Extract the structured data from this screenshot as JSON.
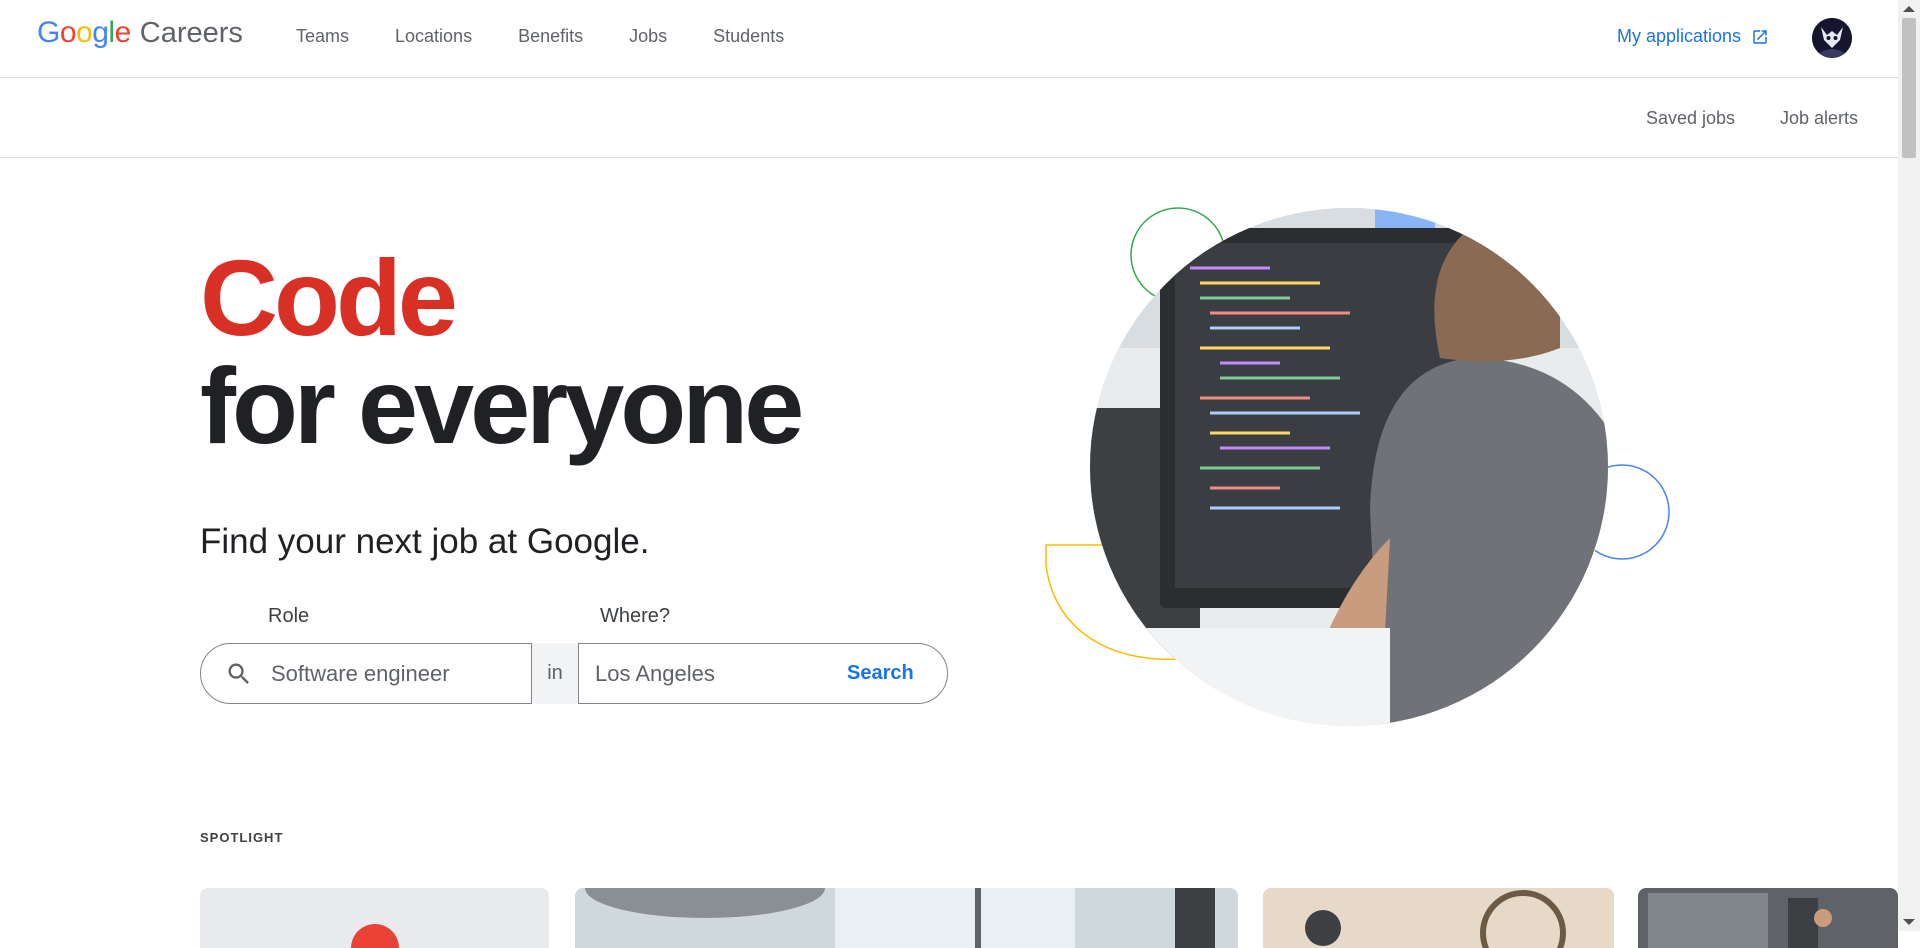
{
  "header": {
    "logo_google": "Google",
    "logo_careers": "Careers",
    "nav": [
      "Teams",
      "Locations",
      "Benefits",
      "Jobs",
      "Students"
    ],
    "my_applications": "My applications"
  },
  "subbar": {
    "saved_jobs": "Saved jobs",
    "job_alerts": "Job alerts"
  },
  "hero": {
    "headline_1": "Code",
    "headline_2": "for everyone",
    "subtitle": "Find your next job at Google."
  },
  "search": {
    "role_label": "Role",
    "where_label": "Where?",
    "role_value": "Software engineer",
    "in_text": "in",
    "where_value": "Los Angeles",
    "button": "Search"
  },
  "spotlight": {
    "heading": "SPOTLIGHT"
  },
  "colors": {
    "red": "#d93025",
    "blue": "#1a73e8",
    "green": "#34a853",
    "yellow": "#fbbc04"
  }
}
